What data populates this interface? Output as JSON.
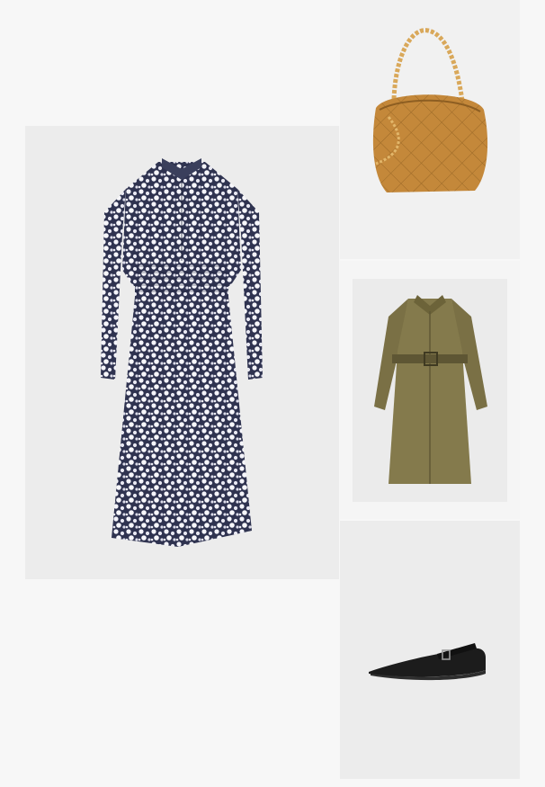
{
  "collage": {
    "background_color": "#f7f7f7",
    "products": [
      {
        "name": "floral-shirt-dress",
        "main_color": "#3a3f5c",
        "accent_color": "#ffffff"
      },
      {
        "name": "quilted-suede-shoulder-bag",
        "main_color": "#c4883a",
        "accent_color": "#d9a85a"
      },
      {
        "name": "belted-trench-coat",
        "main_color": "#7a7045",
        "accent_color": "#5e5634"
      },
      {
        "name": "black-mary-jane-flat",
        "main_color": "#1c1c1c",
        "accent_color": "#9a9a9a"
      }
    ]
  }
}
